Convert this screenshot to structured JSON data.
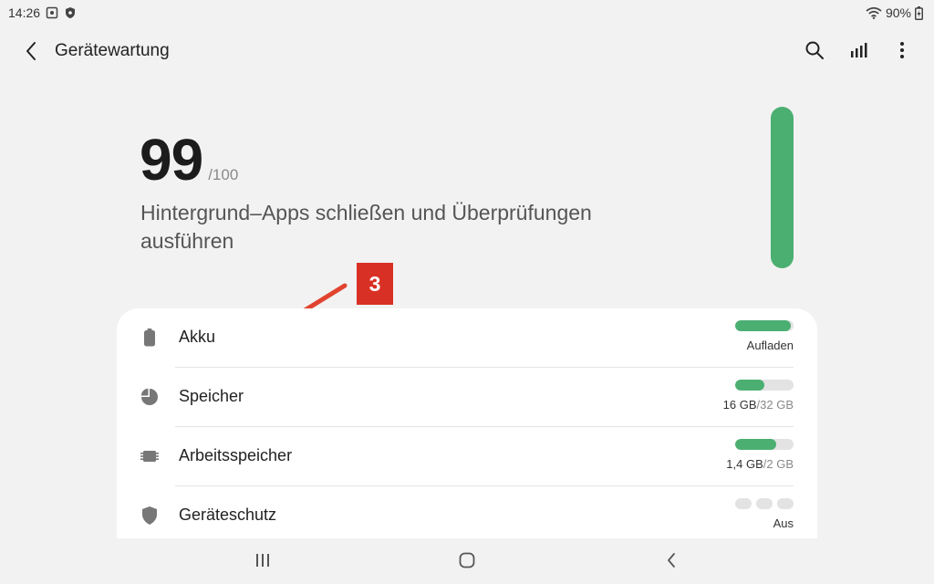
{
  "status_bar": {
    "time": "14:26",
    "battery_percent": "90%"
  },
  "app_bar": {
    "title": "Gerätewartung"
  },
  "score": {
    "value": "99",
    "max": "/100",
    "level": 0.99,
    "description": "Hintergrund–Apps schließen und Überprüfungen ausführen",
    "color": "#4caf72"
  },
  "annotation": {
    "badge": "3",
    "color": "#d93025"
  },
  "items": [
    {
      "label": "Akku",
      "icon": "battery-icon",
      "level": 0.95,
      "status_main": "Aufladen",
      "status_sub": ""
    },
    {
      "label": "Speicher",
      "icon": "storage-pie-icon",
      "level": 0.5,
      "status_main": "16 GB",
      "status_sub": "/32 GB"
    },
    {
      "label": "Arbeitsspeicher",
      "icon": "memory-chip-icon",
      "level": 0.7,
      "status_main": "1,4 GB",
      "status_sub": "/2 GB"
    },
    {
      "label": "Geräteschutz",
      "icon": "shield-icon",
      "status_main": "Aus",
      "status_sub": ""
    }
  ],
  "nav": {
    "recents": "recents-icon",
    "home": "home-icon",
    "back": "back-icon"
  }
}
